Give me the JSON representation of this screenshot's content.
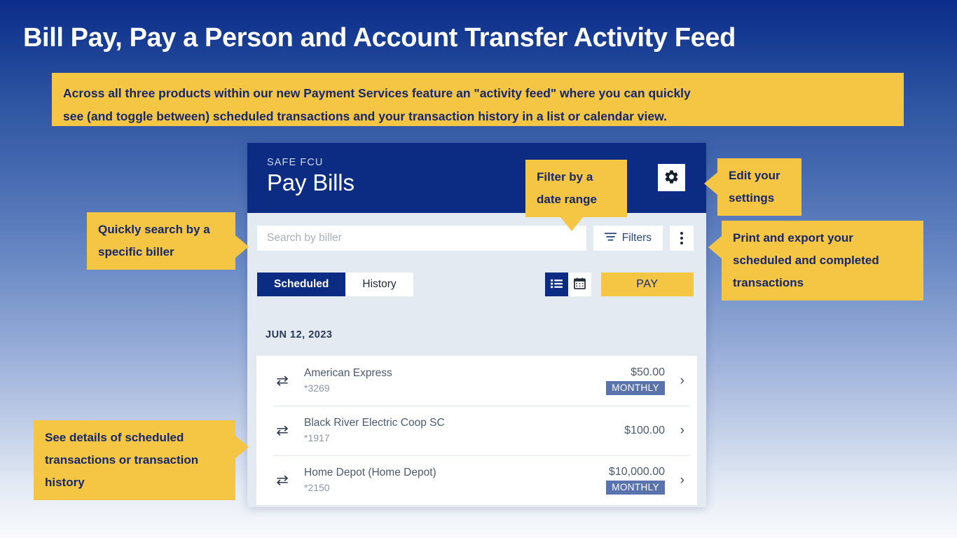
{
  "slide": {
    "title": "Bill Pay, Pay a Person and Account Transfer Activity Feed",
    "description_lines": [
      "Across all three products within our new Payment Services feature an \"activity feed\" where you can quickly",
      "see (and toggle between) scheduled transactions and your transaction history in a list or calendar view."
    ]
  },
  "colors": {
    "brand_navy": "#0c2c84",
    "accent_yellow": "#f5c544",
    "callout_text": "#16276b",
    "badge_blue": "#5a73ad",
    "panel_bg": "#e3eaf2"
  },
  "app": {
    "brand": "SAFE FCU",
    "title": "Pay Bills",
    "settings_icon": "gear-icon",
    "search": {
      "placeholder": "Search by biller",
      "value": ""
    },
    "filters_label": "Filters",
    "filters_icon": "filter-lines-icon",
    "more_icon": "kebab-menu-icon",
    "tabs": [
      {
        "label": "Scheduled",
        "active": true
      },
      {
        "label": "History",
        "active": false
      }
    ],
    "view_toggle": [
      {
        "icon": "list-view-icon",
        "active": true
      },
      {
        "icon": "calendar-view-icon",
        "active": false
      }
    ],
    "pay_button": "PAY",
    "feed": {
      "date_label": "JUN 12, 2023",
      "rows": [
        {
          "icon": "transfer-arrows-icon",
          "name": "American Express",
          "account": "*3269",
          "amount": "$50.00",
          "badge": "MONTHLY",
          "chevron": "chevron-right-icon"
        },
        {
          "icon": "transfer-arrows-icon",
          "name": "Black River Electric Coop SC",
          "account": "*1917",
          "amount": "$100.00",
          "badge": "",
          "chevron": "chevron-right-icon"
        },
        {
          "icon": "transfer-arrows-icon",
          "name": "Home Depot (Home Depot)",
          "account": "*2150",
          "amount": "$10,000.00",
          "badge": "MONTHLY",
          "chevron": "chevron-right-icon"
        }
      ]
    }
  },
  "callouts": {
    "search": "Quickly search by a specific biller",
    "filter": "Filter by a date range",
    "settings": "Edit your settings",
    "print": "Print and export your scheduled and completed transactions",
    "details": "See details of scheduled transactions or transaction history"
  }
}
